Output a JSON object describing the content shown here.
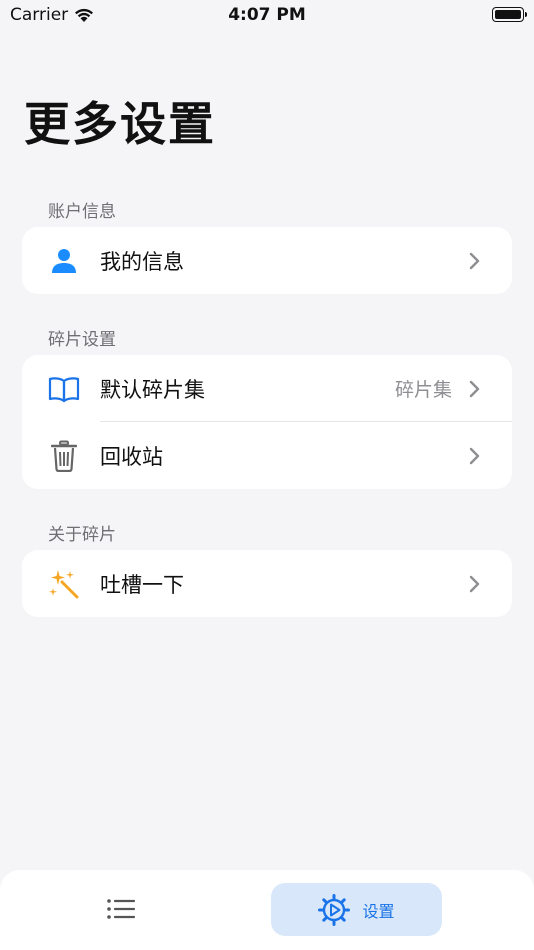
{
  "status_bar": {
    "carrier": "Carrier",
    "time": "4:07 PM"
  },
  "page_title": "更多设置",
  "sections": [
    {
      "label": "账户信息",
      "items": [
        {
          "label": "我的信息",
          "icon": "person-icon",
          "value": ""
        }
      ]
    },
    {
      "label": "碎片设置",
      "items": [
        {
          "label": "默认碎片集",
          "icon": "book-icon",
          "value": "碎片集"
        },
        {
          "label": "回收站",
          "icon": "trash-icon",
          "value": ""
        }
      ]
    },
    {
      "label": "关于碎片",
      "items": [
        {
          "label": "吐槽一下",
          "icon": "sparkle-wand-icon",
          "value": ""
        }
      ]
    }
  ],
  "tab_bar": {
    "tabs": [
      {
        "icon": "list-icon",
        "label": ""
      },
      {
        "icon": "gear-icon",
        "label": "设置",
        "selected": true
      }
    ]
  },
  "colors": {
    "accent": "#1a73e8",
    "selected_tab_bg": "#d8e8fa",
    "background": "#f5f5f7"
  }
}
